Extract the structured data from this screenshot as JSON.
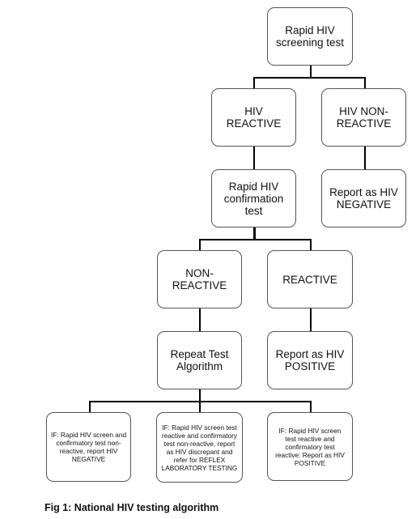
{
  "nodes": {
    "screening": "Rapid HIV screening test",
    "hiv_reactive": "HIV REACTIVE",
    "hiv_non_reactive": "HIV NON-REACTIVE",
    "confirmation": "Rapid HIV confirmation test",
    "report_negative": "Report as HIV NEGATIVE",
    "non_reactive": "NON-REACTIVE",
    "reactive": "REACTIVE",
    "repeat_test": "Repeat Test Algorithm",
    "report_positive": "Report as HIV POSITIVE",
    "outcome_negative": "IF: Rapid HIV screen and confirmatory test non-reactive, report HIV NEGATIVE",
    "outcome_discrepant": "IF: Rapid HIV screen test reactive and confirmatory test non-reactive, report as HIV discrepant and refer for REFLEX LABORATORY TESTING",
    "outcome_positive": "IF: Rapid HIV screen test reactive and confirmatory test reactive: Report as HIV POSITIVE"
  },
  "caption": "Fig 1: National HIV testing algorithm"
}
